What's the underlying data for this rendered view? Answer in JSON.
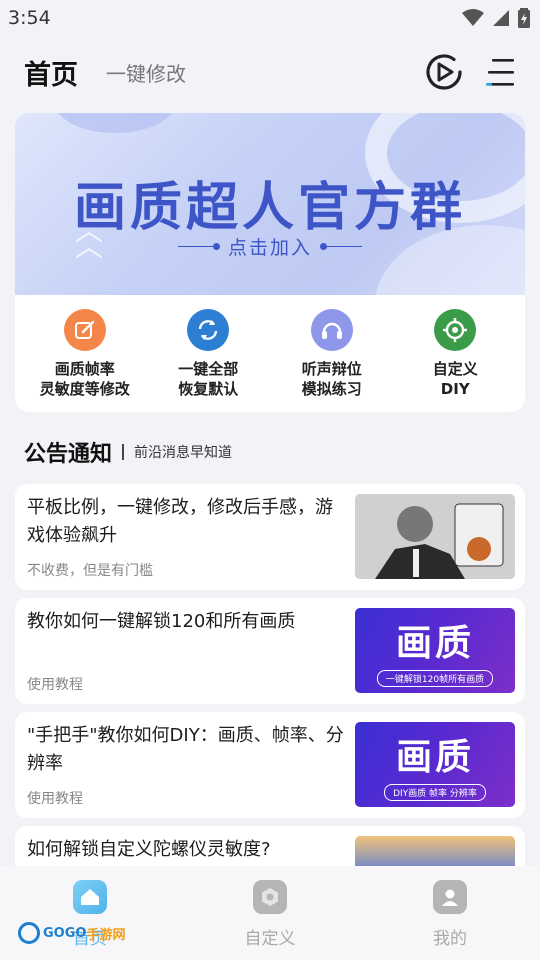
{
  "status_bar": {
    "time": "3:54"
  },
  "header": {
    "title": "首页",
    "subtitle": "一键修改"
  },
  "banner": {
    "title": "画质超人官方群",
    "subtitle": "点击加入"
  },
  "features": [
    {
      "line1": "画质帧率",
      "line2": "灵敏度等修改",
      "icon": "edit-icon",
      "color": "#f4864a"
    },
    {
      "line1": "一键全部",
      "line2": "恢复默认",
      "icon": "refresh-icon",
      "color": "#2d7fd3"
    },
    {
      "line1": "听声辩位",
      "line2": "模拟练习",
      "icon": "headphones-icon",
      "color": "#7b86e6"
    },
    {
      "line1": "自定义",
      "line2": "DIY",
      "icon": "crosshair-icon",
      "color": "#3a9b49"
    }
  ],
  "section": {
    "title": "公告通知",
    "subtitle": "前沿消息早知道"
  },
  "news": [
    {
      "title": "平板比例，一键修改，修改后手感，游戏体验飙升",
      "tag": "不收费，但是有门槛"
    },
    {
      "title": "教你如何一键解锁120和所有画质",
      "tag": "使用教程",
      "thumb_big": "画质",
      "thumb_small": "一键解锁120帧所有画质"
    },
    {
      "title": "\"手把手\"教你如何DIY：画质、帧率、分辨率",
      "tag": "使用教程",
      "thumb_big": "画质",
      "thumb_small": "DIY画质 帧率 分辨率"
    },
    {
      "title": "如何解锁自定义陀螺仪灵敏度?",
      "tag": ""
    }
  ],
  "bottom_nav": [
    {
      "label": "首页",
      "active": true
    },
    {
      "label": "自定义",
      "active": false
    },
    {
      "label": "我的",
      "active": false
    }
  ],
  "watermark": {
    "part1": "GOGO",
    "part2": "手游网"
  },
  "colors": {
    "accent": "#5fb8e8",
    "banner_text": "#3e55c8",
    "purple_thumb": "#4a2dd2"
  }
}
